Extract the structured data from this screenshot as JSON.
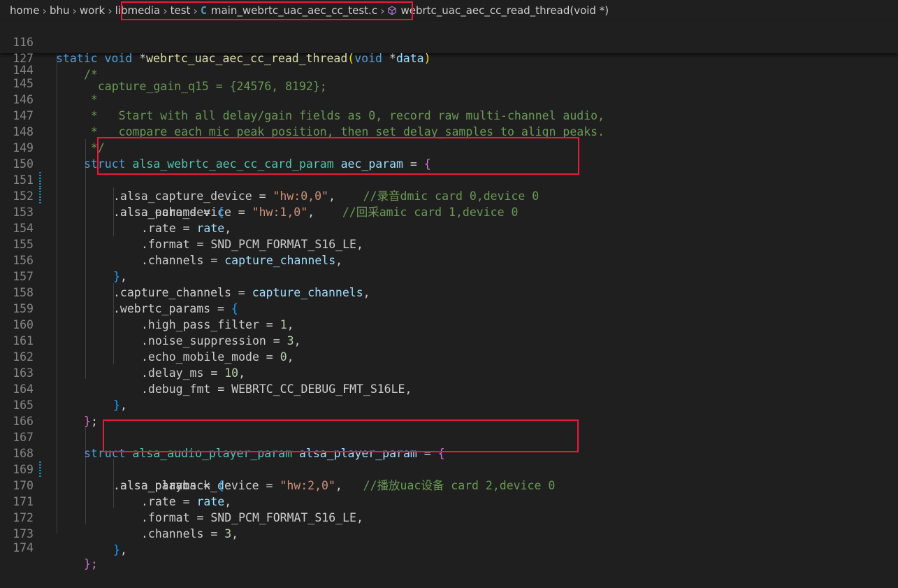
{
  "breadcrumb": {
    "items": [
      "home",
      "bhu",
      "work",
      "libmedia",
      "test",
      "main_webrtc_uac_aec_cc_test.c",
      "webrtc_uac_aec_cc_read_thread(void *)"
    ],
    "file_icon": "C"
  },
  "sticky": {
    "l116": {
      "ln": "116",
      "t1": "static",
      "t2": "void",
      "t3": "*",
      "t4": "webrtc_uac_aec_cc_read_thread",
      "t5": "(",
      "t6": "void",
      "t7": "*",
      "t8": "data",
      "t9": ")"
    },
    "l127": {
      "ln": "127",
      "t1": "/*"
    }
  },
  "code": {
    "l144": {
      "ln": "144",
      "t1": "  capture_gain_q15 = {24576, 8192};"
    },
    "l145": {
      "ln": "145",
      "t1": " *"
    },
    "l146": {
      "ln": "146",
      "t1": " *   Start with all delay/gain fields as 0, record raw multi-channel audio,"
    },
    "l147": {
      "ln": "147",
      "t1": " *   compare each mic peak position, then set delay_samples to align peaks."
    },
    "l148": {
      "ln": "148",
      "t1": " */"
    },
    "l149": {
      "ln": "149",
      "t1": "struct",
      "t2": "alsa_webrtc_aec_cc_card_param",
      "t3": "aec_param",
      "t4": " = ",
      "t5": "{"
    },
    "l150": {
      "ln": "150",
      "t1": ".alsa_capture_device = ",
      "t2": "\"hw:0,0\"",
      "t3": ",    ",
      "t4": "//录音dmic card 0,device 0"
    },
    "l151": {
      "ln": "151",
      "t1": ".alsa_echo_device = ",
      "t2": "\"hw:1,0\"",
      "t3": ",    ",
      "t4": "//回采amic card 1,device 0"
    },
    "l152": {
      "ln": "152",
      "t1": ".alsa_params = ",
      "t2": "{"
    },
    "l153": {
      "ln": "153",
      "t1": ".rate = ",
      "t2": "rate",
      "t3": ","
    },
    "l154": {
      "ln": "154",
      "t1": ".format = SND_PCM_FORMAT_S16_LE,"
    },
    "l155": {
      "ln": "155",
      "t1": ".channels = ",
      "t2": "capture_channels",
      "t3": ","
    },
    "l156": {
      "ln": "156",
      "t1": "}",
      "t2": ","
    },
    "l157": {
      "ln": "157",
      "t1": ".capture_channels = ",
      "t2": "capture_channels",
      "t3": ","
    },
    "l158": {
      "ln": "158",
      "t1": ".webrtc_params = ",
      "t2": "{"
    },
    "l159": {
      "ln": "159",
      "t1": ".high_pass_filter = ",
      "t2": "1",
      "t3": ","
    },
    "l160": {
      "ln": "160",
      "t1": ".noise_suppression = ",
      "t2": "3",
      "t3": ","
    },
    "l161": {
      "ln": "161",
      "t1": ".echo_mobile_mode = ",
      "t2": "0",
      "t3": ","
    },
    "l162": {
      "ln": "162",
      "t1": ".delay_ms = ",
      "t2": "10",
      "t3": ","
    },
    "l163": {
      "ln": "163",
      "t1": ".debug_fmt = WEBRTC_CC_DEBUG_FMT_S16LE,"
    },
    "l164": {
      "ln": "164",
      "t1": "}",
      "t2": ","
    },
    "l165": {
      "ln": "165",
      "t1": "}",
      "t2": ";"
    },
    "l166": {
      "ln": "166"
    },
    "l167": {
      "ln": "167",
      "t1": "struct",
      "t2": "alsa_audio_player_param",
      "t3": "alsa_player_param",
      "t4": " = ",
      "t5": "{"
    },
    "l168": {
      "ln": "168",
      "t1": ".alsa_playback_device = ",
      "t2": "\"hw:2,0\"",
      "t3": ",   ",
      "t4": "//播放uac设备 card 2,device 0"
    },
    "l169": {
      "ln": "169",
      "t1": ".alsa_params = ",
      "t2": "{"
    },
    "l170": {
      "ln": "170",
      "t1": ".rate = ",
      "t2": "rate",
      "t3": ","
    },
    "l171": {
      "ln": "171",
      "t1": ".format = SND_PCM_FORMAT_S16_LE,"
    },
    "l172": {
      "ln": "172",
      "t1": ".channels = ",
      "t2": "3",
      "t3": ","
    },
    "l173": {
      "ln": "173",
      "t1": "}",
      "t2": ","
    },
    "l174": {
      "ln": "174",
      "t1": "};"
    }
  },
  "colors": {
    "editor_bg": "#1f1f1f",
    "keyword": "#569cd6",
    "type": "#4ec9b0",
    "function": "#dcdcaa",
    "variable": "#9cdcfe",
    "string": "#ce9178",
    "number": "#b5cea8",
    "comment": "#6a9955",
    "highlight_box": "#e81a3b"
  }
}
